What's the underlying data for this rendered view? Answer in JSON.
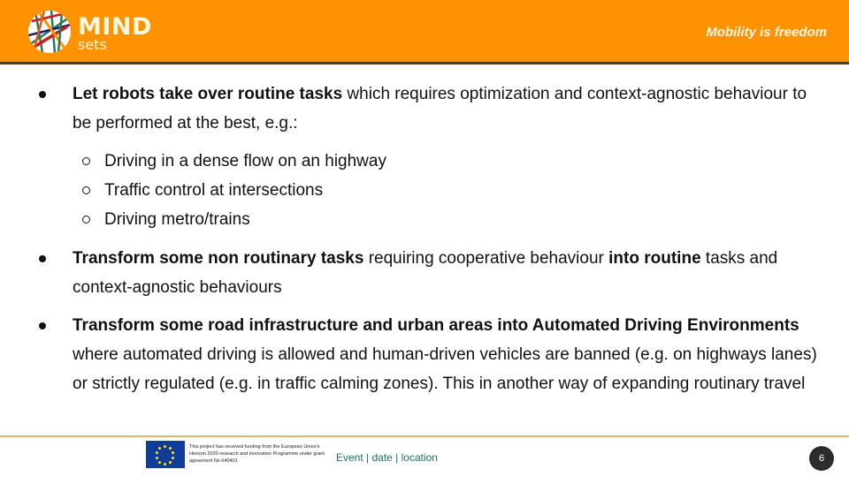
{
  "header": {
    "logo_main": "MIND",
    "logo_sub": "sets",
    "tagline": "Mobility is freedom",
    "accent_color": "#ff9200"
  },
  "bullets": [
    {
      "parts": [
        {
          "text": "Let robots take over routine tasks",
          "bold": true
        },
        {
          "text": " which requires optimization and  context-agnostic behaviour to be performed at the best, e.g.:",
          "bold": false
        }
      ],
      "subitems": [
        "Driving in a dense flow on an highway",
        "Traffic control at intersections",
        "Driving metro/trains"
      ]
    },
    {
      "parts": [
        {
          "text": "Transform some non routinary tasks",
          "bold": true
        },
        {
          "text": " requiring cooperative behaviour ",
          "bold": false
        },
        {
          "text": "into routine",
          "bold": true
        },
        {
          "text": " tasks and context-agnostic behaviours",
          "bold": false
        }
      ]
    },
    {
      "parts": [
        {
          "text": "Transform some road infrastructure and urban areas into Automated Driving Environments",
          "bold": true
        },
        {
          "text": " where automated driving is allowed and human-driven vehicles are banned (e.g. on highways lanes) or strictly regulated (e.g. in traffic calming zones). This in another way of expanding routinary travel",
          "bold": false
        }
      ]
    }
  ],
  "footer": {
    "funding_text": "This project has received funding from the European Union's Horizon 2020 research and innovation Programme under grant agreement No 640401",
    "event_text": "Event | date | location",
    "page_number": "6"
  }
}
